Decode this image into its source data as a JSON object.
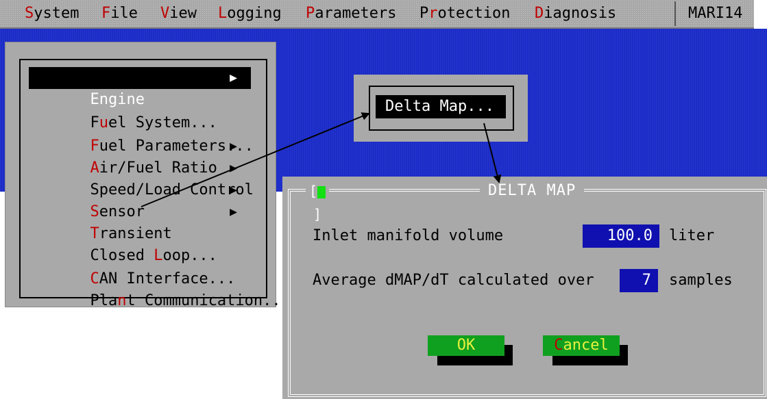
{
  "menubar": {
    "items": [
      {
        "hotkey": "S",
        "rest": "ystem"
      },
      {
        "hotkey": "F",
        "rest": "ile"
      },
      {
        "hotkey": "V",
        "rest": "iew"
      },
      {
        "hotkey": "L",
        "rest": "ogging"
      },
      {
        "hotkey": "P",
        "rest": "arameters"
      },
      {
        "pre": "P",
        "hotkey": "r",
        "rest": "otection"
      },
      {
        "hotkey": "D",
        "rest": "iagnosis"
      }
    ],
    "system_name": "MARI14"
  },
  "dropdown": {
    "items": [
      {
        "pre": "Engine",
        "hotkey": "",
        "rest": "",
        "submenu": true,
        "selected": true
      },
      {
        "pre": "F",
        "hotkey": "u",
        "rest": "el System...",
        "submenu": false
      },
      {
        "pre": "",
        "hotkey": "F",
        "rest": "uel Parameters...",
        "submenu": false
      },
      {
        "pre": "",
        "hotkey": "A",
        "rest": "ir/Fuel Ratio",
        "submenu": true
      },
      {
        "pre": "Speed/Load Control",
        "hotkey": "",
        "rest": "",
        "submenu": true
      },
      {
        "pre": "",
        "hotkey": "S",
        "rest": "ensor",
        "submenu": true
      },
      {
        "pre": "",
        "hotkey": "T",
        "rest": "ransient",
        "submenu": true
      },
      {
        "pre": "Closed ",
        "hotkey": "L",
        "rest": "oop...",
        "submenu": false
      },
      {
        "pre": "",
        "hotkey": "C",
        "rest": "AN Interface...",
        "submenu": false
      },
      {
        "pre": "Pla",
        "hotkey": "n",
        "rest": "t Communication...",
        "submenu": false
      }
    ],
    "arrow_glyph": "▶"
  },
  "submenu": {
    "item": "Delta Map..."
  },
  "dialog": {
    "close_left": "[",
    "close_right": "]",
    "title": "DELTA MAP",
    "fields": [
      {
        "label": "Inlet manifold volume",
        "value": "100.0",
        "unit": "liter"
      },
      {
        "label": "Average dMAP/dT calculated over",
        "value": "7",
        "unit": "samples"
      }
    ],
    "ok_label": "OK",
    "cancel_hotkey": "C",
    "cancel_rest": "ancel"
  },
  "colors": {
    "desktop": "#1a2bc8",
    "menu_gray": "#a9a9a9",
    "hotkey_red": "#c00000",
    "field_blue": "#1010b0",
    "button_green": "#10a020",
    "close_green": "#12e012"
  }
}
